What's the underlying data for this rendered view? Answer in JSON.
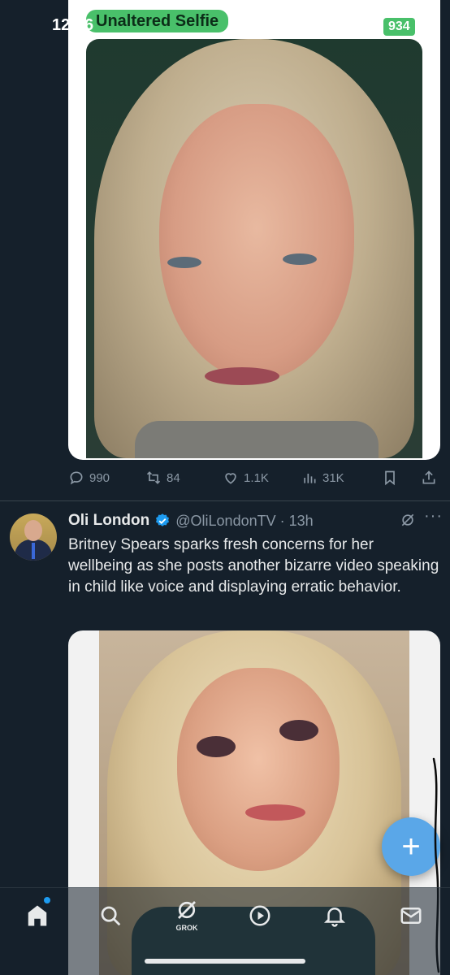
{
  "status_bar": {
    "time": "12:36"
  },
  "top_tweet": {
    "media_overlay_label": "Unaltered Selfie",
    "media_overlay_count": "934",
    "actions": {
      "replies": "990",
      "reposts": "84",
      "likes": "1.1K",
      "views": "31K"
    }
  },
  "tweet": {
    "author_name": "Oli London",
    "handle_time": "@OliLondonTV · 13h",
    "text": "Britney Spears sparks fresh concerns for her wellbeing as she posts another bizarre video speaking in child like voice and displaying erratic behavior.",
    "more_label": "···"
  },
  "fab": {
    "label": "+"
  },
  "bottom_nav": {
    "grok_label": "GROK"
  },
  "colors": {
    "background": "#15202b",
    "accent": "#1d9bf0",
    "label_green": "#49c06a",
    "fab": "#5aa7e8"
  }
}
